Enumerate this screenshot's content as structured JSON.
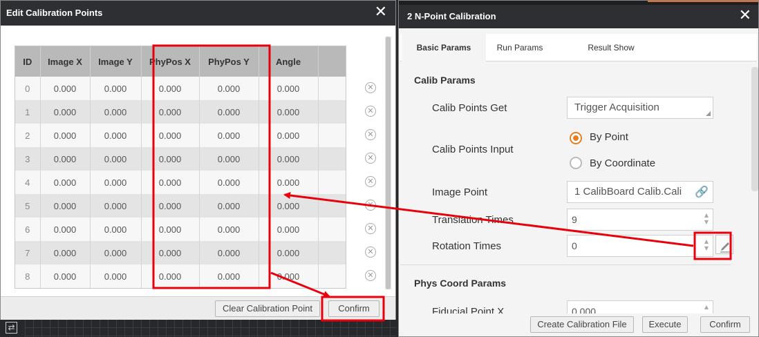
{
  "left_dialog": {
    "title": "Edit Calibration Points",
    "close_glyph": "✕",
    "columns": [
      "ID",
      "Image X",
      "Image Y",
      "PhyPos X",
      "PhyPos Y",
      "Angle"
    ],
    "rows": [
      [
        "0",
        "0.000",
        "0.000",
        "0.000",
        "0.000",
        "0.000"
      ],
      [
        "1",
        "0.000",
        "0.000",
        "0.000",
        "0.000",
        "0.000"
      ],
      [
        "2",
        "0.000",
        "0.000",
        "0.000",
        "0.000",
        "0.000"
      ],
      [
        "3",
        "0.000",
        "0.000",
        "0.000",
        "0.000",
        "0.000"
      ],
      [
        "4",
        "0.000",
        "0.000",
        "0.000",
        "0.000",
        "0.000"
      ],
      [
        "5",
        "0.000",
        "0.000",
        "0.000",
        "0.000",
        "0.000"
      ],
      [
        "6",
        "0.000",
        "0.000",
        "0.000",
        "0.000",
        "0.000"
      ],
      [
        "7",
        "0.000",
        "0.000",
        "0.000",
        "0.000",
        "0.000"
      ],
      [
        "8",
        "0.000",
        "0.000",
        "0.000",
        "0.000",
        "0.000"
      ]
    ],
    "delete_glyph": "✕",
    "clear_button": "Clear Calibration Point",
    "confirm_button": "Confirm"
  },
  "background_strip": {
    "icon_glyph": "⇄"
  },
  "right_dialog": {
    "title": "2 N-Point Calibration",
    "close_glyph": "✕",
    "tabs": [
      "Basic Params",
      "Run Params",
      "Result Show"
    ],
    "active_tab": "Basic Params",
    "calib_params": {
      "section_title": "Calib Params",
      "calib_points_get": {
        "label": "Calib Points Get",
        "value": "Trigger Acquisition"
      },
      "calib_points_input": {
        "label": "Calib Points Input",
        "options": [
          "By Point",
          "By Coordinate"
        ],
        "selected": "By Point"
      },
      "image_point": {
        "label": "Image Point",
        "value": "1 CalibBoard Calib.Cali",
        "link_glyph": "🔗"
      },
      "translation_times": {
        "label": "Translation Times",
        "value": "9"
      },
      "rotation_times": {
        "label": "Rotation Times",
        "value": "0"
      }
    },
    "phys_coord_params": {
      "section_title": "Phys Coord Params",
      "fiducial_point_x": {
        "label": "Fiducial Point X",
        "value": "0.000"
      }
    },
    "spin_up": "▲",
    "spin_down": "▼",
    "footer": {
      "create_file_button": "Create Calibration File",
      "execute_button": "Execute",
      "confirm_button": "Confirm"
    }
  },
  "annotation_color": "#e8000b"
}
